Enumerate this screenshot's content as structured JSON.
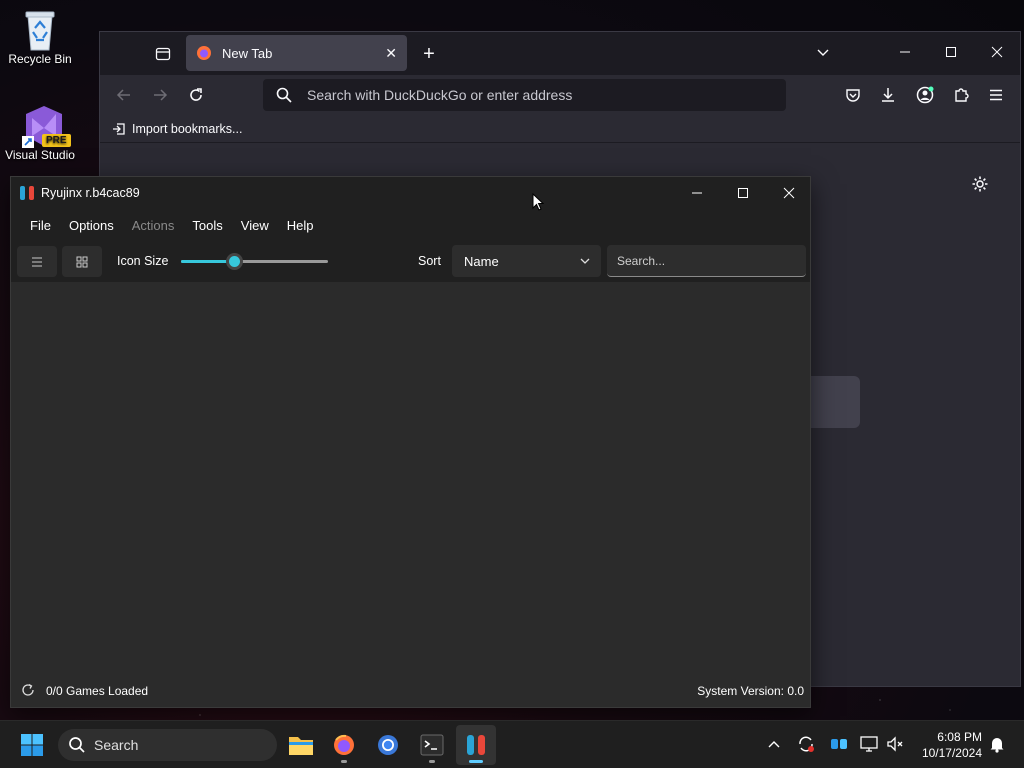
{
  "desktop": {
    "icons": [
      {
        "label": "Recycle Bin"
      },
      {
        "label": "Visual Studio Code",
        "badge": "PRE"
      }
    ]
  },
  "firefox": {
    "tab_title": "New Tab",
    "url_placeholder": "Search with DuckDuckGo or enter address",
    "bookmarks_label": "Import bookmarks..."
  },
  "ryujinx": {
    "title": "Ryujinx r.b4cac89",
    "menu": {
      "file": "File",
      "options": "Options",
      "actions": "Actions",
      "tools": "Tools",
      "view": "View",
      "help": "Help"
    },
    "toolbar": {
      "icon_size_label": "Icon Size",
      "icon_size_value": 0.36,
      "sort_label": "Sort",
      "sort_value": "Name",
      "search_placeholder": "Search..."
    },
    "status": {
      "games_loaded": "0/0 Games Loaded",
      "system_version": "System Version: 0.0"
    }
  },
  "taskbar": {
    "search_label": "Search",
    "time": "6:08 PM",
    "date": "10/17/2024"
  },
  "colors": {
    "accent": "#37c8dc",
    "taskbar_indicator": "#60cdff"
  }
}
